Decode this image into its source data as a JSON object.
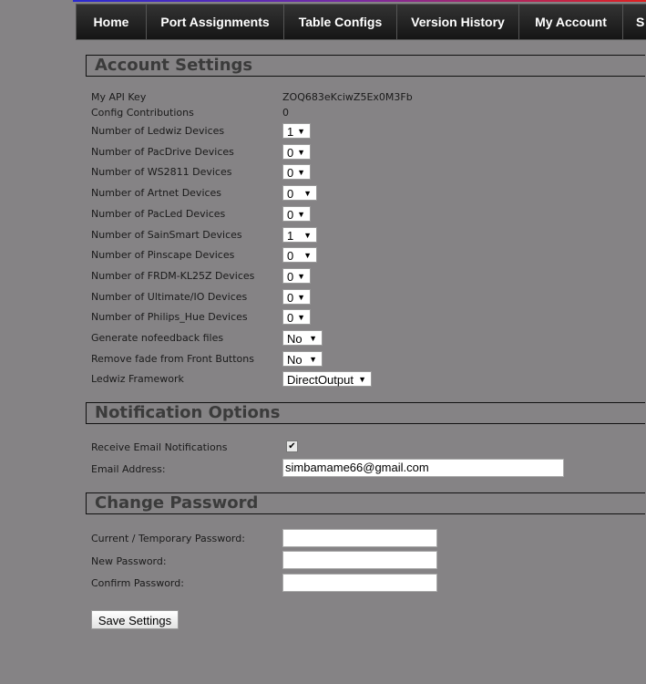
{
  "nav": [
    "Home",
    "Port Assignments",
    "Table Configs",
    "Version History",
    "My Account",
    "S"
  ],
  "sections": {
    "account": "Account Settings",
    "notify": "Notification Options",
    "password": "Change Password"
  },
  "api_key": {
    "label": "My API Key",
    "value": "ZOQ683eKciwZ5Ex0M3Fb"
  },
  "contributions": {
    "label": "Config Contributions",
    "value": "0"
  },
  "settings": [
    {
      "label": "Number of Ledwiz Devices",
      "value": "1",
      "wide": false
    },
    {
      "label": "Number of PacDrive Devices",
      "value": "0",
      "wide": false
    },
    {
      "label": "Number of WS2811 Devices",
      "value": "0",
      "wide": false
    },
    {
      "label": "Number of Artnet Devices",
      "value": "0",
      "wide": true
    },
    {
      "label": "Number of PacLed Devices",
      "value": "0",
      "wide": false
    },
    {
      "label": "Number of SainSmart Devices",
      "value": "1",
      "wide": true
    },
    {
      "label": "Number of Pinscape Devices",
      "value": "0",
      "wide": true
    },
    {
      "label": "Number of FRDM-KL25Z Devices",
      "value": "0",
      "wide": false
    },
    {
      "label": "Number of Ultimate/IO Devices",
      "value": "0",
      "wide": false
    },
    {
      "label": "Number of Philips_Hue Devices",
      "value": "0",
      "wide": false
    },
    {
      "label": "Generate nofeedback files",
      "value": "No",
      "wide": "no"
    },
    {
      "label": "Remove fade from Front Buttons",
      "value": "No",
      "wide": "no"
    },
    {
      "label": "Ledwiz Framework",
      "value": "DirectOutput",
      "wide": "do"
    }
  ],
  "notifications": {
    "receive_label": "Receive Email Notifications",
    "receive_checked": true,
    "email_label": "Email Address:",
    "email_value": "simbamame66@gmail.com"
  },
  "password": {
    "current_label": "Current / Temporary Password:",
    "new_label": "New Password:",
    "confirm_label": "Confirm Password:"
  },
  "save_label": "Save Settings"
}
